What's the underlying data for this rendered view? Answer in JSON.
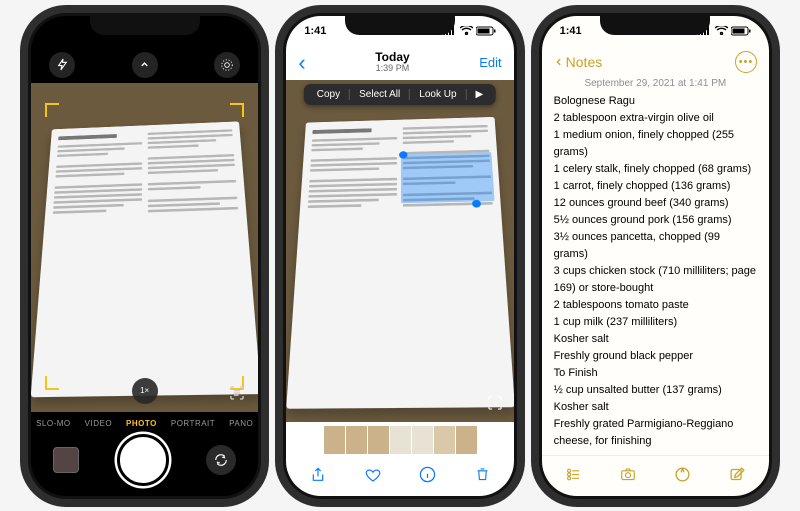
{
  "camera": {
    "time": " ",
    "top_icons": [
      "flash-icon",
      "chevron-up-icon",
      "live-photo-icon"
    ],
    "modes": [
      "SLO-MO",
      "VIDEO",
      "PHOTO",
      "PORTRAIT",
      "PANO"
    ],
    "active_mode": "PHOTO",
    "zoom": "1×"
  },
  "photos": {
    "time": "1:41",
    "back": "‹",
    "title_line1": "Today",
    "title_line2": "1:39 PM",
    "edit": "Edit",
    "context_menu": [
      "Copy",
      "Select All",
      "Look Up",
      "▶"
    ],
    "toolbar": [
      "share-icon",
      "heart-icon",
      "info-icon",
      "trash-icon"
    ],
    "thumbnails_count": 7
  },
  "notes": {
    "time": "1:41",
    "back_label": "Notes",
    "more": "•••",
    "timestamp": "September 29, 2021 at 1:41 PM",
    "lines": [
      "Bolognese Ragu",
      "2 tablespoon extra-virgin olive oil",
      "1 medium onion, finely chopped (255 grams)",
      "1 celery stalk, finely chopped (68 grams)",
      "1 carrot, finely chopped (136 grams)",
      "12 ounces ground beef (340 grams)",
      "5½ ounces ground pork (156 grams)",
      "3½ ounces pancetta, chopped (99 grams)",
      "3 cups chicken stock (710 milliliters; page 169) or store-bought",
      "2 tablespoons tomato paste",
      "1 cup milk (237 milliliters)",
      "Kosher salt",
      "Freshly ground black pepper",
      "To Finish",
      "½ cup unsalted butter (137 grams)",
      "Kosher salt",
      "Freshly grated Parmigiano-Reggiano cheese, for finishing"
    ],
    "toolbar": [
      "checklist-icon",
      "camera-icon",
      "marker-icon",
      "compose-icon"
    ]
  }
}
